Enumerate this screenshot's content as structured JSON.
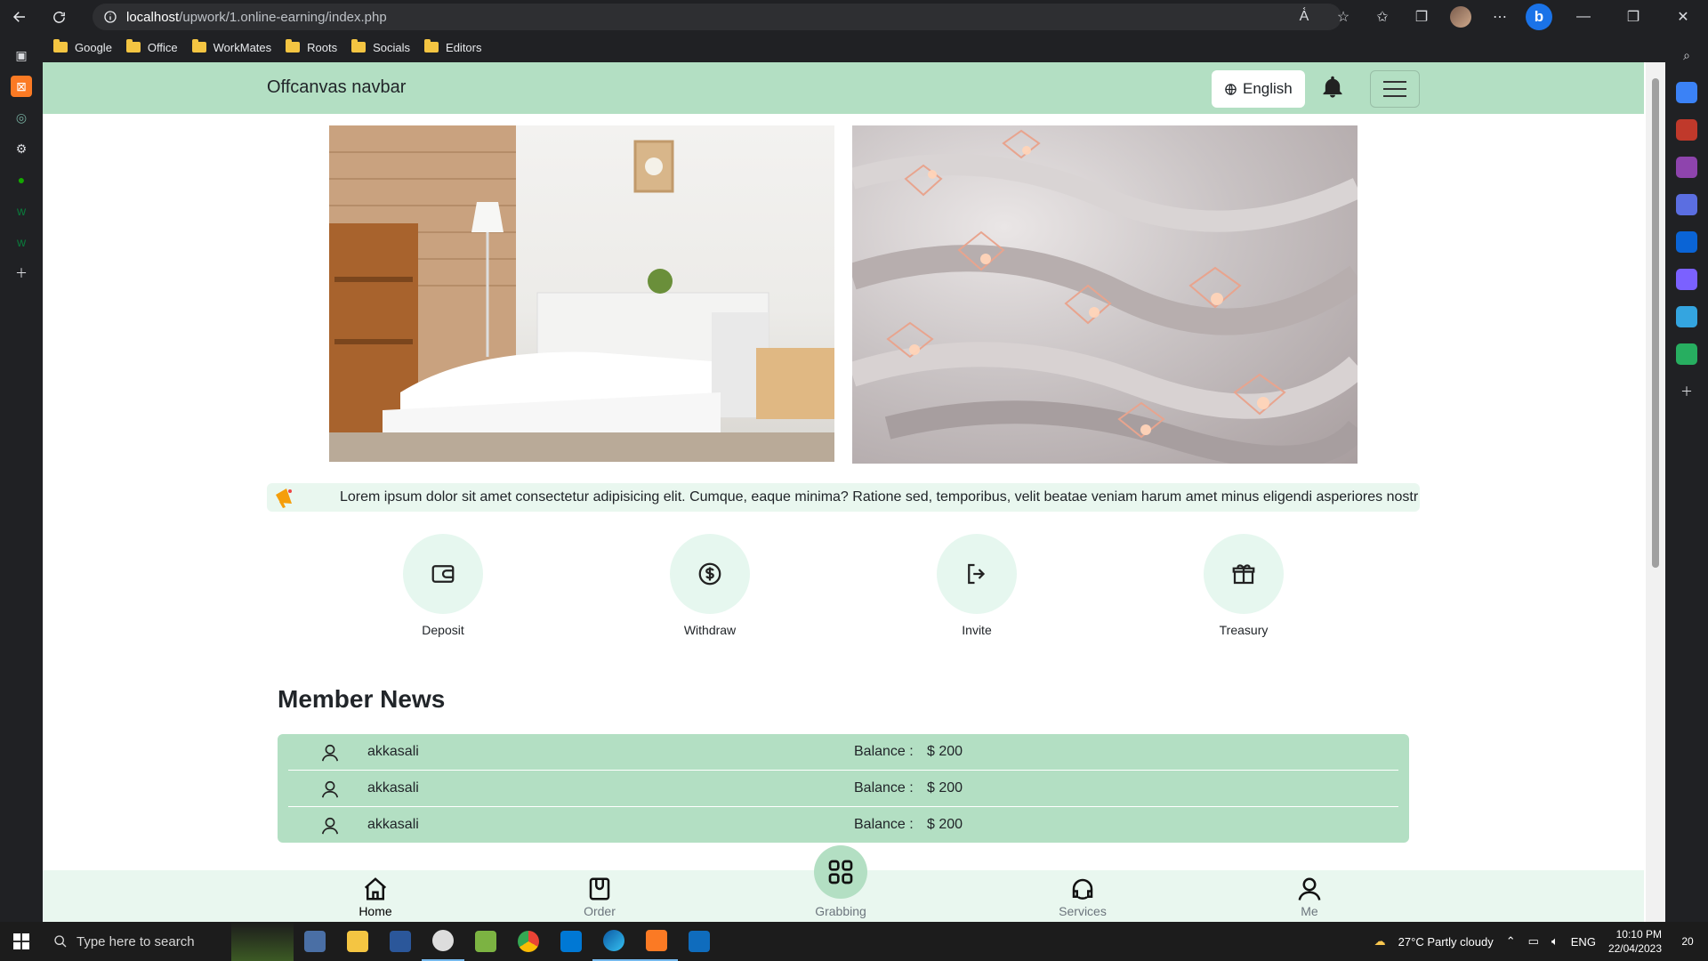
{
  "browser": {
    "url_host": "localhost",
    "url_path": "/upwork/1.online-earning/index.php",
    "bookmarks": [
      "Google",
      "Office",
      "WorkMates",
      "Roots",
      "Socials",
      "Editors"
    ]
  },
  "navbar": {
    "brand": "Offcanvas navbar",
    "language": "English"
  },
  "ticker": {
    "text": "Lorem ipsum dolor sit amet consectetur adipisicing elit. Cumque, eaque minima? Ratione sed, temporibus, velit beatae veniam harum amet minus eligendi asperiores nostr"
  },
  "actions": [
    {
      "label": "Deposit",
      "icon": "wallet-icon"
    },
    {
      "label": "Withdraw",
      "icon": "dollar-icon"
    },
    {
      "label": "Invite",
      "icon": "logout-icon"
    },
    {
      "label": "Treasury",
      "icon": "gift-icon"
    }
  ],
  "news": {
    "title": "Member News",
    "rows": [
      {
        "name": "akkasali",
        "balance_label": "Balance :",
        "balance": "$ 200"
      },
      {
        "name": "akkasali",
        "balance_label": "Balance :",
        "balance": "$ 200"
      },
      {
        "name": "akkasali",
        "balance_label": "Balance :",
        "balance": "$ 200"
      }
    ]
  },
  "bottom_nav": [
    {
      "label": "Home",
      "icon": "home-icon",
      "active": true
    },
    {
      "label": "Order",
      "icon": "bag-icon",
      "active": false
    },
    {
      "label": "Grabbing",
      "icon": "grid-icon",
      "active": false
    },
    {
      "label": "Services",
      "icon": "headset-icon",
      "active": false
    },
    {
      "label": "Me",
      "icon": "user-icon",
      "active": false
    }
  ],
  "taskbar": {
    "search_placeholder": "Type here to search",
    "weather": "27°C  Partly cloudy",
    "lang": "ENG",
    "time": "10:10 PM",
    "date": "22/04/2023",
    "notifications": "20"
  },
  "colors": {
    "accent": "#b3dfc3",
    "accent_light": "#e9f7ef"
  }
}
